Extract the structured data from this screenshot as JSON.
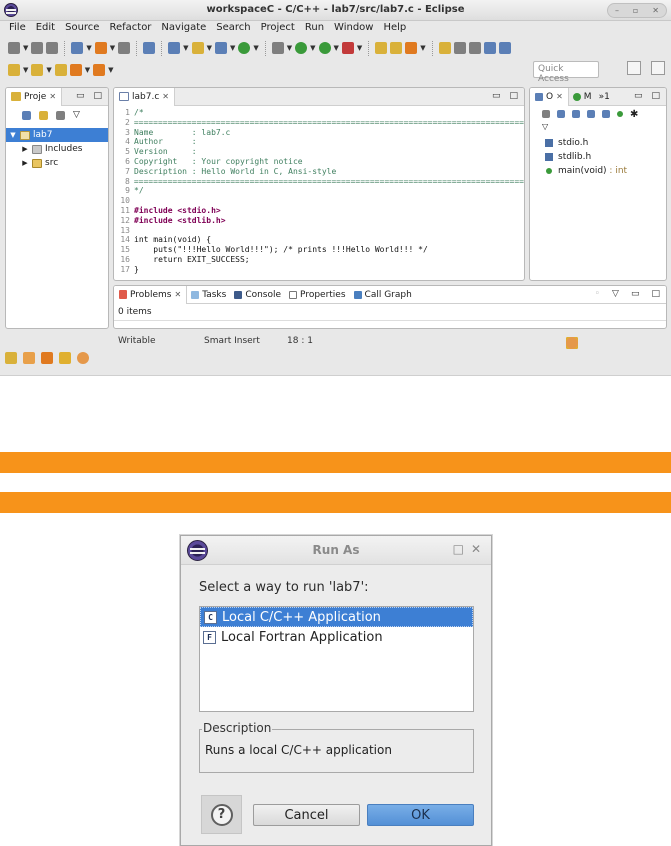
{
  "window": {
    "title": "workspaceC - C/C++ - lab7/src/lab7.c - Eclipse"
  },
  "menu": [
    "File",
    "Edit",
    "Source",
    "Refactor",
    "Navigate",
    "Search",
    "Project",
    "Run",
    "Window",
    "Help"
  ],
  "toolbar": {
    "quick_access_placeholder": "Quick Access"
  },
  "project_explorer": {
    "tab_label": "Proje",
    "tree": [
      {
        "label": "lab7",
        "expanded": true,
        "selected": true
      },
      {
        "label": "Includes",
        "expanded": false
      },
      {
        "label": "src",
        "expanded": false
      }
    ]
  },
  "editor": {
    "tab_label": "lab7.c",
    "lines": [
      {
        "n": "1",
        "text": "/*",
        "kind": "cm"
      },
      {
        "n": "2",
        "text": "=================================================================================",
        "kind": "cm"
      },
      {
        "n": "3",
        "text": "Name        : lab7.c",
        "kind": "cm"
      },
      {
        "n": "4",
        "text": "Author      :",
        "kind": "cm"
      },
      {
        "n": "5",
        "text": "Version     :",
        "kind": "cm"
      },
      {
        "n": "6",
        "text": "Copyright   : Your copyright notice",
        "kind": "cm"
      },
      {
        "n": "7",
        "text": "Description : Hello World in C, Ansi-style",
        "kind": "cm"
      },
      {
        "n": "8",
        "text": "=================================================================================",
        "kind": "cm"
      },
      {
        "n": "9",
        "text": "*/",
        "kind": "cm"
      },
      {
        "n": "10",
        "text": "",
        "kind": "kw"
      },
      {
        "n": "11",
        "text": "#include <stdio.h>",
        "kind": "pp"
      },
      {
        "n": "12",
        "text": "#include <stdlib.h>",
        "kind": "pp"
      },
      {
        "n": "13",
        "text": "",
        "kind": "kw"
      },
      {
        "n": "14",
        "text": "int main(void) {",
        "kind": "kw"
      },
      {
        "n": "15",
        "text": "    puts(\"!!!Hello World!!!\"); /* prints !!!Hello World!!! */",
        "kind": "kw"
      },
      {
        "n": "16",
        "text": "    return EXIT_SUCCESS;",
        "kind": "kw"
      },
      {
        "n": "17",
        "text": "}",
        "kind": "kw"
      }
    ]
  },
  "outline": {
    "tab_label": "O",
    "tab2_label": "M",
    "overflow_label": "»1",
    "items": [
      {
        "label": "stdio.h",
        "type": ""
      },
      {
        "label": "stdlib.h",
        "type": ""
      },
      {
        "label": "main(void)",
        "type": " : int"
      }
    ]
  },
  "bottom_panel": {
    "tabs": [
      "Problems",
      "Tasks",
      "Console",
      "Properties",
      "Call Graph"
    ],
    "items_count": "0 items"
  },
  "statusbar": {
    "writable": "Writable",
    "insert_mode": "Smart Insert",
    "position": "18 : 1"
  },
  "dialog": {
    "title": "Run As",
    "prompt": "Select a way to run 'lab7':",
    "options": [
      {
        "icon": "C",
        "label": "Local C/C++ Application",
        "selected": true
      },
      {
        "icon": "F",
        "label": "Local Fortran Application",
        "selected": false
      }
    ],
    "description_legend": "Description",
    "description_text": "Runs a local C/C++ application",
    "help_glyph": "?",
    "cancel_label": "Cancel",
    "ok_label": "OK"
  },
  "colors": {
    "accent_stripe": "#f7931a",
    "selection": "#3d7fd4",
    "ok_button": "#5390d6"
  }
}
